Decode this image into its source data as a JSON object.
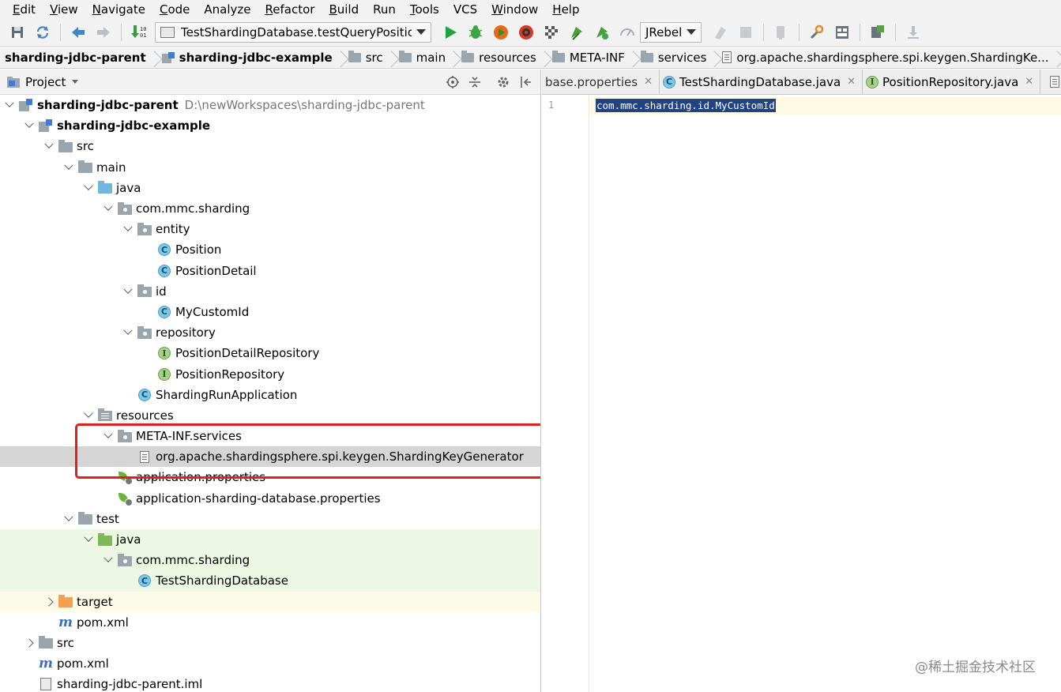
{
  "menu": {
    "items": [
      {
        "label": "Edit",
        "mnemonic": "E",
        "rest": "dit"
      },
      {
        "label": "View",
        "mnemonic": "V",
        "rest": "iew"
      },
      {
        "label": "Navigate",
        "mnemonic": "N",
        "rest": "avigate"
      },
      {
        "label": "Code",
        "mnemonic": "C",
        "rest": "ode"
      },
      {
        "label": "Analyze",
        "mnemonic": "",
        "rest": "Analyze"
      },
      {
        "label": "Refactor",
        "mnemonic": "R",
        "rest": "efactor"
      },
      {
        "label": "Build",
        "mnemonic": "B",
        "rest": "uild"
      },
      {
        "label": "Run",
        "mnemonic": "",
        "rest": "Run"
      },
      {
        "label": "Tools",
        "mnemonic": "T",
        "rest": "ools"
      },
      {
        "label": "VCS",
        "mnemonic": "",
        "rest": "VCS"
      },
      {
        "label": "Window",
        "mnemonic": "W",
        "rest": "indow"
      },
      {
        "label": "Help",
        "mnemonic": "H",
        "rest": "elp"
      }
    ]
  },
  "toolbar": {
    "run_config": "TestShardingDatabase.testQueryPosition",
    "jrebel": "JRebel",
    "colors": {
      "run": "#22a33b",
      "debug": "#3ea446",
      "coverage": "#e56a1a",
      "jrebel_red": "#d23b2b"
    }
  },
  "breadcrumb": {
    "items": [
      {
        "label": "sharding-jdbc-parent",
        "bold": true,
        "icon": "none"
      },
      {
        "label": "sharding-jdbc-example",
        "bold": true,
        "icon": "module-icon"
      },
      {
        "label": "src",
        "bold": false,
        "icon": "folder-icon"
      },
      {
        "label": "main",
        "bold": false,
        "icon": "folder-icon"
      },
      {
        "label": "resources",
        "bold": false,
        "icon": "resources-folder-icon"
      },
      {
        "label": "META-INF",
        "bold": false,
        "icon": "folder-icon"
      },
      {
        "label": "services",
        "bold": false,
        "icon": "folder-icon"
      },
      {
        "label": "org.apache.shardingsphere.spi.keygen.ShardingKe...",
        "bold": false,
        "icon": "file-icon"
      }
    ]
  },
  "project_panel": {
    "title": "Project",
    "tree": [
      {
        "depth": 0,
        "arrow": "down",
        "icon": "module",
        "label": "sharding-jdbc-parent",
        "bold": true,
        "path": "D:\\newWorkspaces\\sharding-jdbc-parent"
      },
      {
        "depth": 1,
        "arrow": "down",
        "icon": "module",
        "label": "sharding-jdbc-example",
        "bold": true
      },
      {
        "depth": 2,
        "arrow": "down",
        "icon": "folder",
        "label": "src"
      },
      {
        "depth": 3,
        "arrow": "down",
        "icon": "folder",
        "label": "main"
      },
      {
        "depth": 4,
        "arrow": "down",
        "icon": "folder-blue",
        "label": "java"
      },
      {
        "depth": 5,
        "arrow": "down",
        "icon": "package",
        "label": "com.mmc.sharding"
      },
      {
        "depth": 6,
        "arrow": "down",
        "icon": "package",
        "label": "entity"
      },
      {
        "depth": 7,
        "arrow": "none",
        "icon": "class",
        "label": "Position"
      },
      {
        "depth": 7,
        "arrow": "none",
        "icon": "class",
        "label": "PositionDetail"
      },
      {
        "depth": 6,
        "arrow": "down",
        "icon": "package",
        "label": "id"
      },
      {
        "depth": 7,
        "arrow": "none",
        "icon": "class",
        "label": "MyCustomId"
      },
      {
        "depth": 6,
        "arrow": "down",
        "icon": "package",
        "label": "repository"
      },
      {
        "depth": 7,
        "arrow": "none",
        "icon": "interface",
        "label": "PositionDetailRepository"
      },
      {
        "depth": 7,
        "arrow": "none",
        "icon": "interface",
        "label": "PositionRepository"
      },
      {
        "depth": 6,
        "arrow": "none",
        "icon": "spring-class",
        "label": "ShardingRunApplication"
      },
      {
        "depth": 4,
        "arrow": "down",
        "icon": "resources",
        "label": "resources"
      },
      {
        "depth": 5,
        "arrow": "down",
        "icon": "package",
        "label": "META-INF.services"
      },
      {
        "depth": 6,
        "arrow": "none",
        "icon": "file",
        "label": "org.apache.shardingsphere.spi.keygen.ShardingKeyGenerator",
        "selected": true
      },
      {
        "depth": 5,
        "arrow": "none",
        "icon": "spring-properties",
        "label": "application.properties"
      },
      {
        "depth": 5,
        "arrow": "none",
        "icon": "spring-properties",
        "label": "application-sharding-database.properties"
      },
      {
        "depth": 3,
        "arrow": "down",
        "icon": "folder",
        "label": "test"
      },
      {
        "depth": 4,
        "arrow": "down",
        "icon": "folder-green",
        "label": "java",
        "bg": "test"
      },
      {
        "depth": 5,
        "arrow": "down",
        "icon": "package",
        "label": "com.mmc.sharding",
        "bg": "test"
      },
      {
        "depth": 6,
        "arrow": "none",
        "icon": "spring-class",
        "label": "TestShardingDatabase",
        "bg": "test"
      },
      {
        "depth": 2,
        "arrow": "right",
        "icon": "folder-orange",
        "label": "target",
        "bg": "target"
      },
      {
        "depth": 2,
        "arrow": "none",
        "icon": "maven",
        "label": "pom.xml"
      },
      {
        "depth": 1,
        "arrow": "right",
        "icon": "folder",
        "label": "src"
      },
      {
        "depth": 1,
        "arrow": "none",
        "icon": "maven",
        "label": "pom.xml"
      },
      {
        "depth": 1,
        "arrow": "none",
        "icon": "iml",
        "label": "sharding-jdbc-parent.iml"
      }
    ]
  },
  "editor": {
    "tabs": [
      {
        "label": "base.properties",
        "icon": "none",
        "active": false
      },
      {
        "label": "TestShardingDatabase.java",
        "icon": "class",
        "active": false
      },
      {
        "label": "PositionRepository.java",
        "icon": "interface",
        "active": false
      }
    ],
    "line_number": "1",
    "code": "com.mmc.sharding.id.MyCustomId"
  },
  "watermark": "@稀土掘金技术社区"
}
